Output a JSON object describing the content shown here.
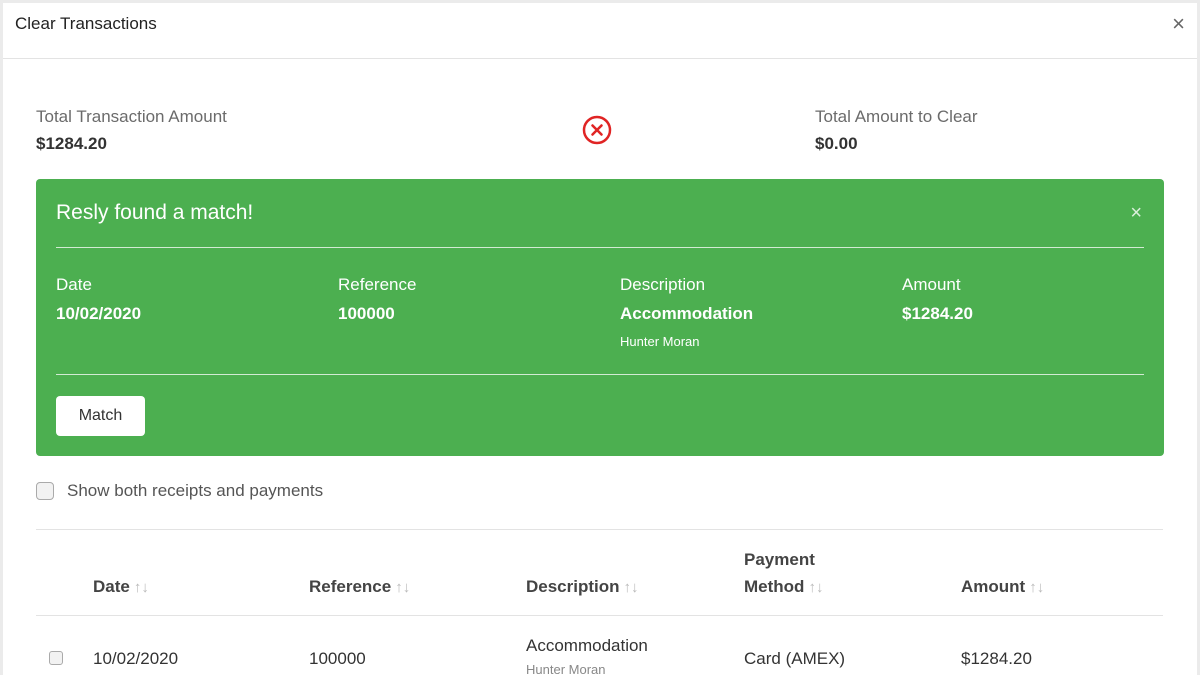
{
  "modal": {
    "title": "Clear Transactions"
  },
  "totals": {
    "transaction_label": "Total Transaction Amount",
    "transaction_value": "$1284.20",
    "clear_label": "Total Amount to Clear",
    "clear_value": "$0.00",
    "status_icon": "x-circle-icon",
    "status_color": "#e02424"
  },
  "match": {
    "title": "Resly found a match!",
    "background_color": "#4caf50",
    "fields": {
      "date_label": "Date",
      "date_value": "10/02/2020",
      "reference_label": "Reference",
      "reference_value": "100000",
      "description_label": "Description",
      "description_value": "Accommodation",
      "description_sub": "Hunter Moran",
      "amount_label": "Amount",
      "amount_value": "$1284.20"
    },
    "button_label": "Match"
  },
  "toggle": {
    "label": "Show both receipts and payments",
    "checked": false
  },
  "table": {
    "columns": {
      "date": "Date",
      "reference": "Reference",
      "description": "Description",
      "payment_method_line1": "Payment",
      "payment_method_line2": "Method",
      "amount": "Amount"
    },
    "sort_glyph": "↑↓",
    "rows": [
      {
        "date": "10/02/2020",
        "reference": "100000",
        "description": "Accommodation",
        "description_sub": "Hunter Moran",
        "payment_method": "Card (AMEX)",
        "amount": "$1284.20"
      }
    ]
  }
}
